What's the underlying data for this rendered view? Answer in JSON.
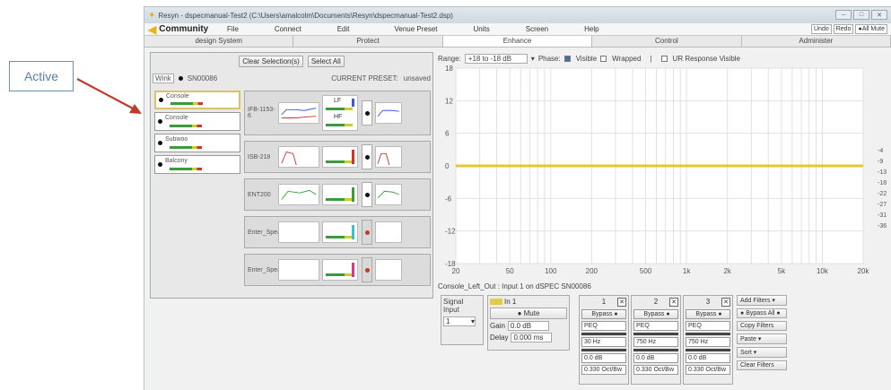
{
  "callout": {
    "label": "Active",
    "arrow_color": "#c0392b"
  },
  "window": {
    "title": "Resyn - dspecmanual-Test2 (C:\\Users\\amalcolm\\Documents\\Resyn\\dspecmanual-Test2.dsp)",
    "controls": [
      "–",
      "□",
      "✕"
    ]
  },
  "menubar": {
    "brand": "Community",
    "items": [
      "File",
      "Connect",
      "Edit",
      "Venue Preset",
      "Units",
      "Screen",
      "Help"
    ],
    "right": [
      "Undo",
      "Redo",
      "All Mute"
    ]
  },
  "tabs": [
    {
      "label": "design System",
      "active": false
    },
    {
      "label": "Protect",
      "active": false
    },
    {
      "label": "Enhance",
      "active": true
    },
    {
      "label": "Control",
      "active": false
    },
    {
      "label": "Administer",
      "active": false
    }
  ],
  "left": {
    "clear_label": "Clear Selection(s)",
    "select_all_label": "Select All",
    "wink_label": "Wink",
    "serial": "SN00086",
    "preset_label": "CURRENT PRESET:",
    "preset_value": "unsaved",
    "sources": [
      {
        "name": "Console",
        "active": true
      },
      {
        "name": "Console",
        "active": false
      },
      {
        "name": "Subwoo",
        "active": false
      },
      {
        "name": "Balcony",
        "active": false
      }
    ],
    "outputs": [
      {
        "name": "IFB-1153-6",
        "big": true,
        "muted": false,
        "lf": "LF",
        "hf": "HF",
        "peak_color": "#3b5bd6"
      },
      {
        "name": "ISB-218",
        "big": false,
        "muted": false,
        "peak_color": "#d03030"
      },
      {
        "name": "ENT200",
        "big": false,
        "muted": false,
        "peak_color": "#3a9b3a"
      },
      {
        "name": "Enter_Spea",
        "big": false,
        "muted": true,
        "peak_color": "#3bbfd6"
      },
      {
        "name": "Enter_Spea",
        "big": false,
        "muted": true,
        "peak_color": "#d63b8a"
      }
    ]
  },
  "graph": {
    "range_label": "Range:",
    "range_value": "+18 to -18 dB",
    "phase_label": "Phase:",
    "visible_label": "Visible",
    "visible_checked": true,
    "wrapped_label": "Wrapped",
    "wrapped_checked": false,
    "ur_label": "UR Response Visible",
    "ur_checked": false
  },
  "chart_data": {
    "type": "line",
    "xscale": "log",
    "xlim": [
      20,
      20000
    ],
    "ylim": [
      -18,
      18
    ],
    "x_ticks": [
      "20",
      "50",
      "100",
      "200",
      "500",
      "1k",
      "2k",
      "5k",
      "10k",
      "20k"
    ],
    "x_tick_values": [
      20,
      50,
      100,
      200,
      500,
      1000,
      2000,
      5000,
      10000,
      20000
    ],
    "y_ticks": [
      18,
      12,
      6,
      0,
      -6,
      -12,
      -18
    ],
    "right_ticks": [
      "-4",
      "-9",
      "-13",
      "-18",
      "-22",
      "-27",
      "-31",
      "-36"
    ],
    "series": [
      {
        "color": "#e8c531",
        "x": [
          20,
          20000
        ],
        "y": [
          0,
          0
        ]
      }
    ],
    "grid": true
  },
  "channel": {
    "info": "Console_Left_Out : Input 1 on dSPEC SN00086",
    "signal_label": "Signal Input",
    "signal_value": "1",
    "input_name": "In 1",
    "mute_label": "Mute",
    "gain_label": "Gain",
    "gain_value": "0.0 dB",
    "delay_label": "Delay",
    "delay_value": "0.000 ms"
  },
  "filters": [
    {
      "num": "1",
      "bypass": "Bypass",
      "type": "PEQ",
      "freq": "30 Hz",
      "gain": "0.0 dB",
      "bw": "0.330 Oct/Bw"
    },
    {
      "num": "2",
      "bypass": "Bypass",
      "type": "PEQ",
      "freq": "750 Hz",
      "gain": "0.0 dB",
      "bw": "0.330 Oct/Bw"
    },
    {
      "num": "3",
      "bypass": "Bypass",
      "type": "PEQ",
      "freq": "750 Hz",
      "gain": "0.0 dB",
      "bw": "0.330 Oct/Bw"
    }
  ],
  "actions": [
    "Add Filters",
    "Bypass All",
    "Copy Filters",
    "Paste",
    "Sort",
    "Clear Filters"
  ]
}
